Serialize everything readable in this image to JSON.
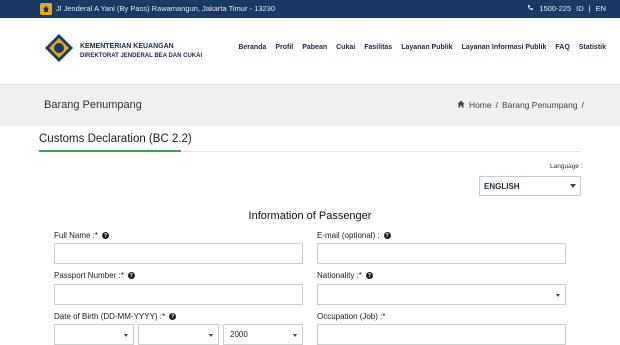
{
  "topbar": {
    "address": "Jl Jenderal A Yani (By Pass) Rawamangun, Jakarta Timur - 13230",
    "phone": "1500-225",
    "lang_id": "ID",
    "sep": "|",
    "lang_en": "EN"
  },
  "brand": {
    "line1": "KEMENTERIAN KEUANGAN",
    "line2": "DIREKTORAT JENDERAL BEA DAN CUKAI"
  },
  "nav": [
    "Beranda",
    "Profil",
    "Pabean",
    "Cukai",
    "Fasilitas",
    "Layanan Publik",
    "Layanan Informasi Publik",
    "FAQ",
    "Statistik"
  ],
  "page": {
    "title": "Barang Penumpang",
    "crumb_home": "Home",
    "crumb_sep": "/",
    "crumb_current": "Barang Penumpang",
    "crumb_end": "/"
  },
  "section": {
    "heading": "Customs Declaration (BC 2.2)"
  },
  "language": {
    "label": "Language :",
    "selected": "ENGLISH"
  },
  "form": {
    "title": "Information of Passenger",
    "full_name_label": "Full Name :*",
    "email_label": "E-mail (optional) :",
    "passport_label": "Passport Number :*",
    "nationality_label": "Nationality :*",
    "dob_label": "Date of Birth (DD-MM-YYYY) :*",
    "dob_year": "2000",
    "occupation_label": "Occupation (Job) :*"
  },
  "colors": {
    "topbar": "#1a3a66",
    "accent": "#3aa653",
    "band": "#f0f0f0"
  }
}
